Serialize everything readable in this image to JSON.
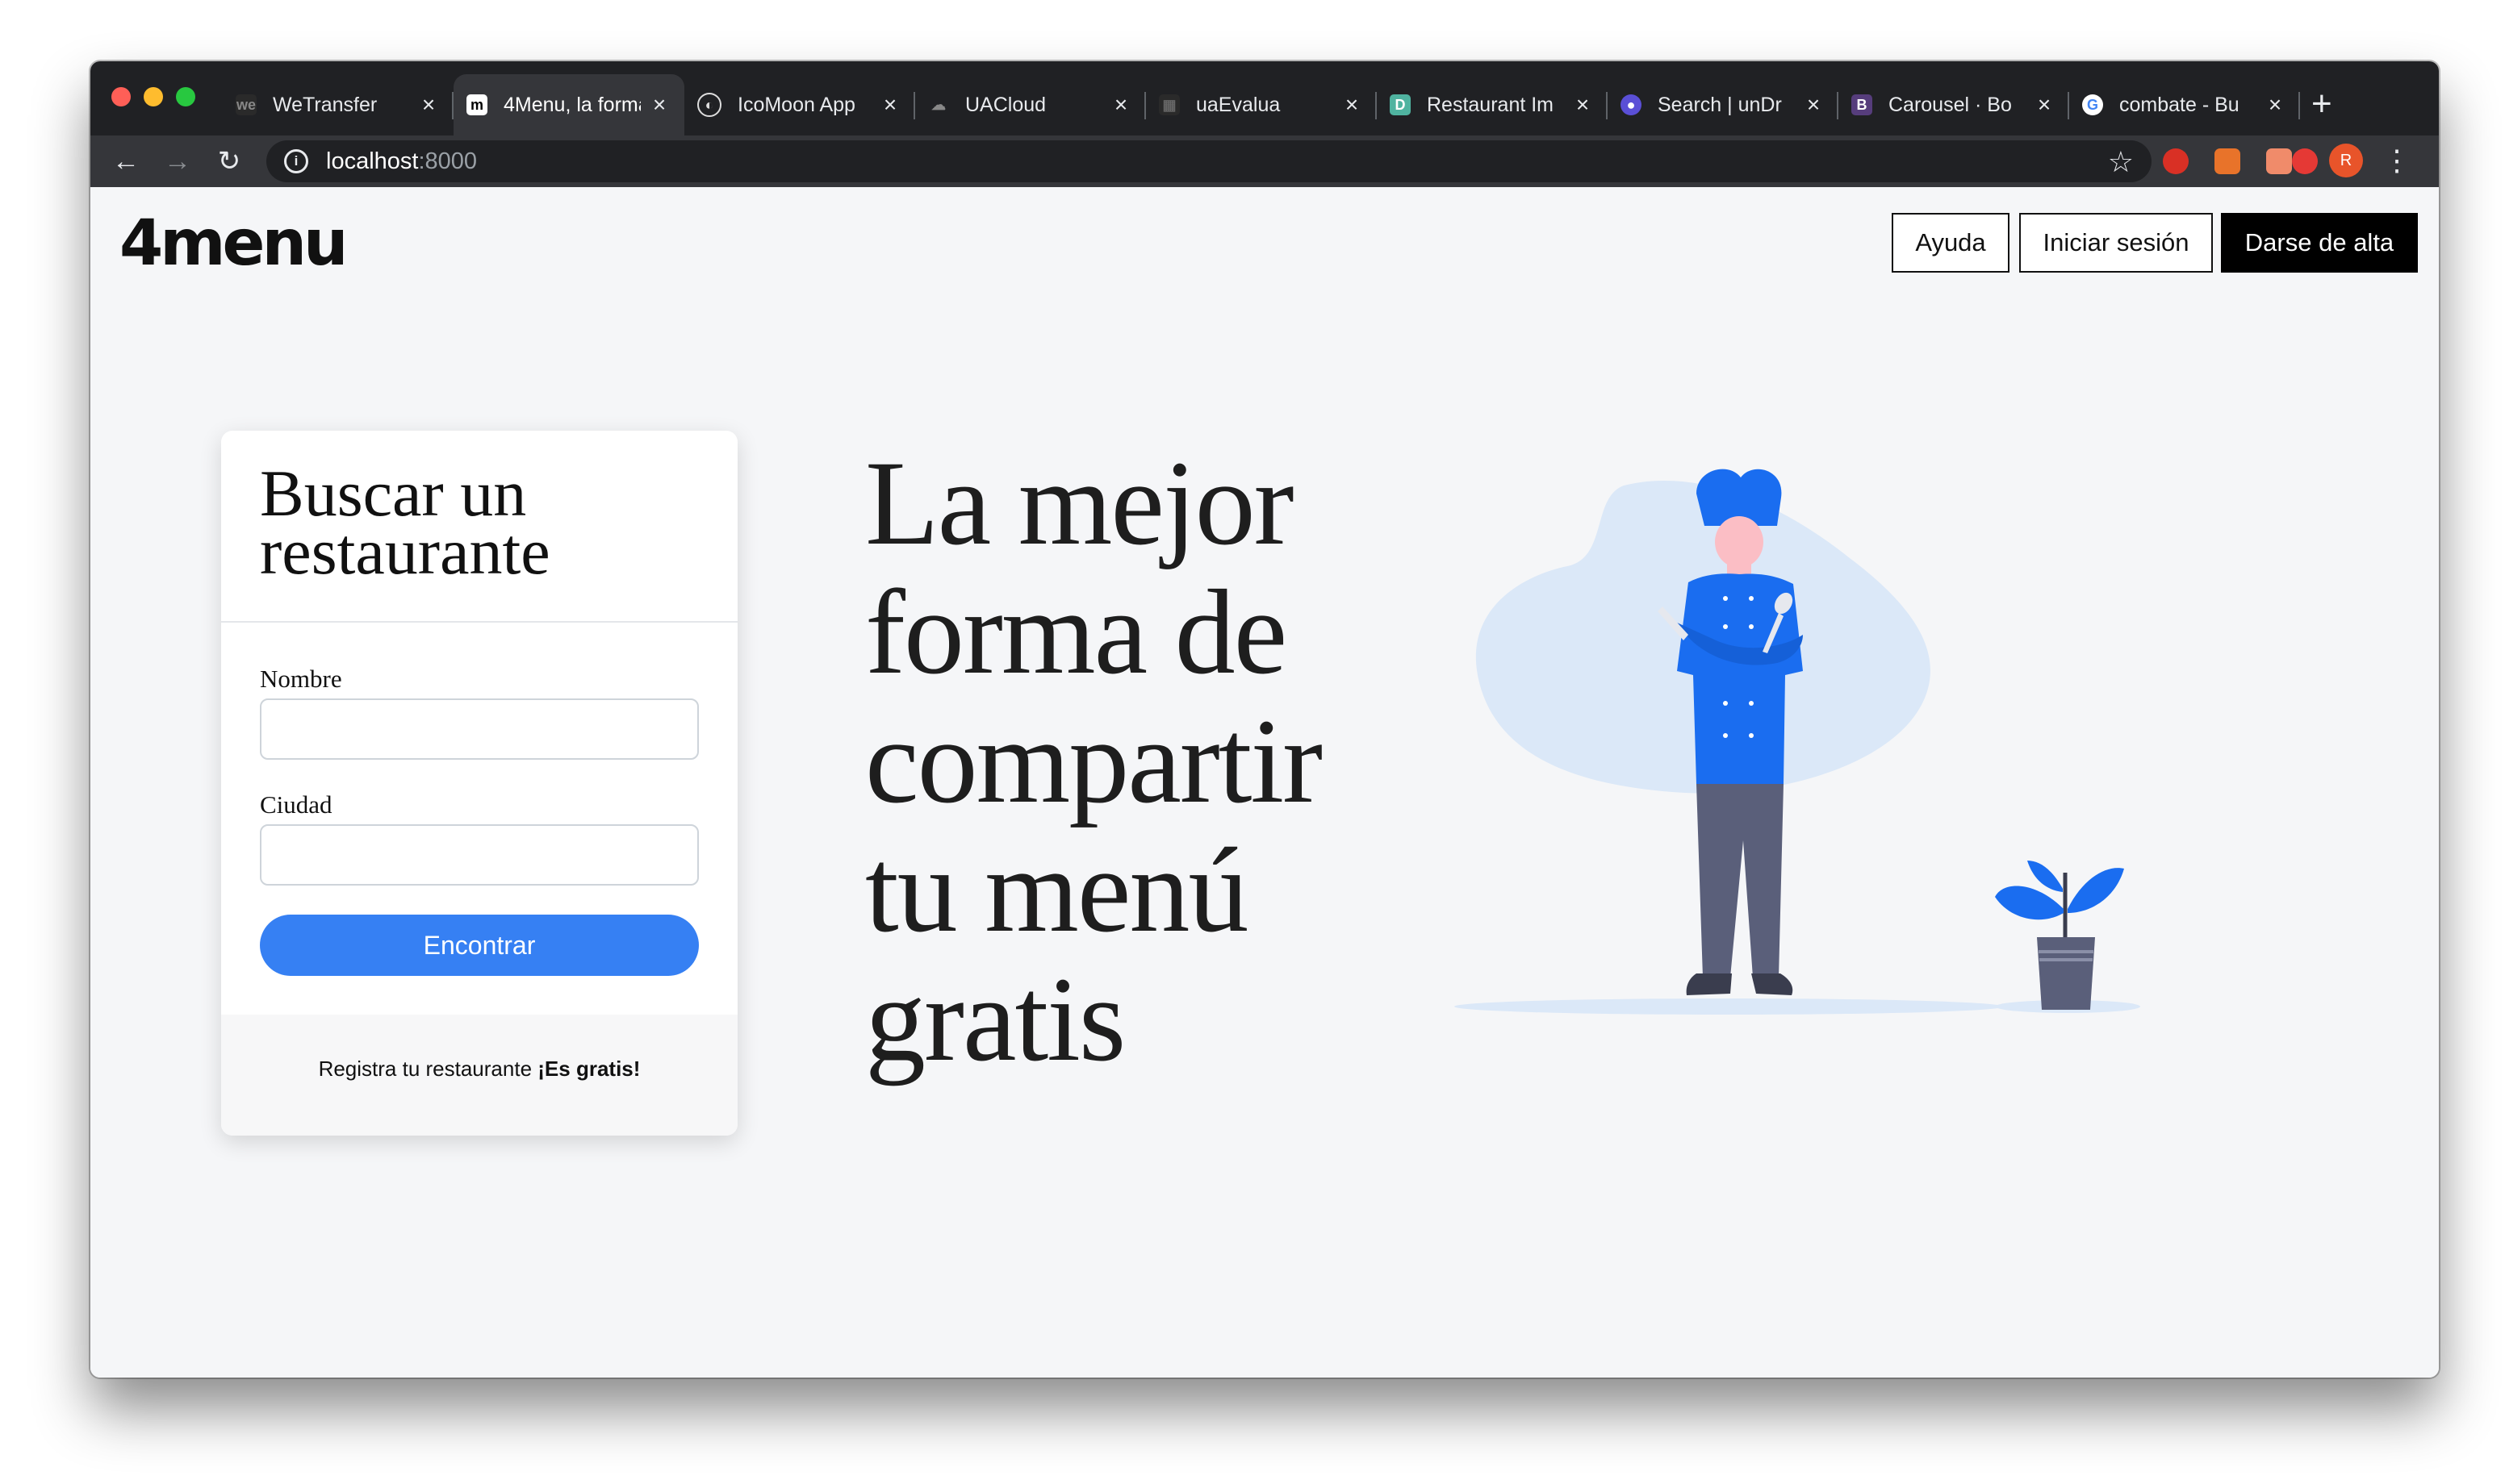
{
  "browser": {
    "tabs": [
      {
        "title": "WeTransfer",
        "favicon": "wetransfer-icon",
        "active": false
      },
      {
        "title": "4Menu, la forma",
        "favicon": "4menu-icon",
        "active": true
      },
      {
        "title": "IcoMoon App",
        "favicon": "icomoon-icon",
        "active": false
      },
      {
        "title": "UACloud",
        "favicon": "cloud-icon",
        "active": false
      },
      {
        "title": "uaEvalua",
        "favicon": "uaevalua-icon",
        "active": false
      },
      {
        "title": "Restaurant Im",
        "favicon": "restaurant-icon",
        "active": false
      },
      {
        "title": "Search | unDr",
        "favicon": "undraw-icon",
        "active": false
      },
      {
        "title": "Carousel · Bo",
        "favicon": "bootstrap-icon",
        "active": false
      },
      {
        "title": "combate - Bu",
        "favicon": "google-icon",
        "active": false
      }
    ],
    "url_host": "localhost",
    "url_port": ":8000",
    "profile_initial": "R"
  },
  "header": {
    "logo_text": "4menu",
    "help_label": "Ayuda",
    "login_label": "Iniciar sesión",
    "signup_label": "Darse de alta"
  },
  "search_card": {
    "title": "Buscar un restaurante",
    "name_label": "Nombre",
    "name_value": "",
    "city_label": "Ciudad",
    "city_value": "",
    "find_label": "Encontrar",
    "register_text": "Registra tu restaurante ",
    "register_bold": "¡Es gratis!"
  },
  "hero": {
    "headline": "La mejor forma de compartir tu menú gratis"
  },
  "colors": {
    "accent": "#3680f3",
    "illustration_blue": "#1a6df0",
    "blob": "#dbe8f8"
  }
}
